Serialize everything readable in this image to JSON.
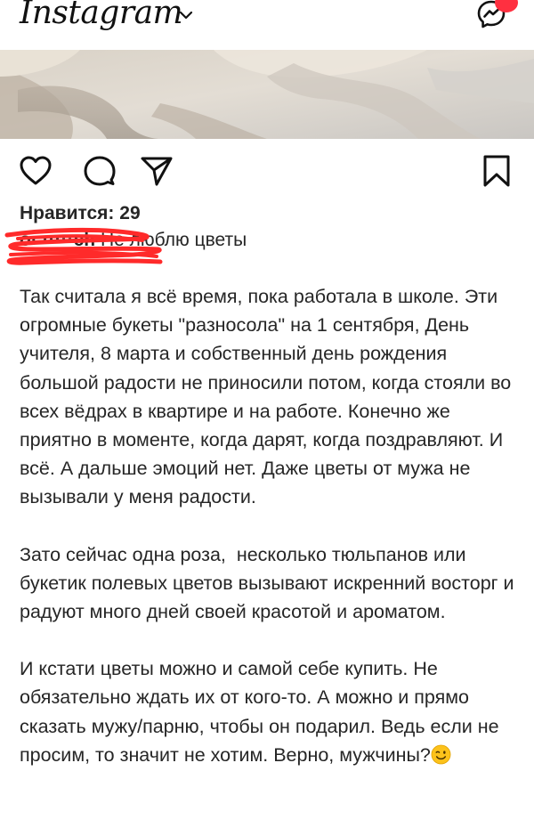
{
  "header": {
    "logo_text": "Instagram",
    "chevron_icon": "chevron-down-icon",
    "messenger_icon": "messenger-icon"
  },
  "colors": {
    "badge": "#ff3040",
    "text": "#262626",
    "redaction": "#ff2a2a"
  },
  "post": {
    "image_description_icon": "post-photo",
    "actions": {
      "like_icon": "heart-icon",
      "comment_icon": "comment-icon",
      "share_icon": "send-icon",
      "save_icon": "bookmark-icon"
    },
    "likes_text": "Нравится: 29",
    "caption": {
      "username": "o· ·····ch",
      "title_text": " Не люблю цветы"
    },
    "paragraphs": [
      "Так считала я всё время, пока работала в школе. Эти огромные букеты \"разносола\" на 1 сентября, День учителя, 8 марта и собственный день рождения большой радости не приносили потом, когда стояли во всех вёдрах в квартире и на работе. Конечно же приятно в моменте, когда дарят, когда поздравляют. И всё. А дальше эмоций нет. Даже цветы от мужа не вызывали у меня радости.",
      "Зато сейчас одна роза,  несколько тюльпанов или букетик полевых цветов вызывают искренний восторг и радуют много дней своей красотой и ароматом.",
      "И кстати цветы можно и самой себе купить. Не обязательно ждать их от кого-то. А можно и прямо сказать мужу/парню, чтобы он подарил. Ведь если не просим, то значит не хотим. Верно, мужчины?"
    ],
    "emoji_icon": "winking-face-emoji"
  }
}
